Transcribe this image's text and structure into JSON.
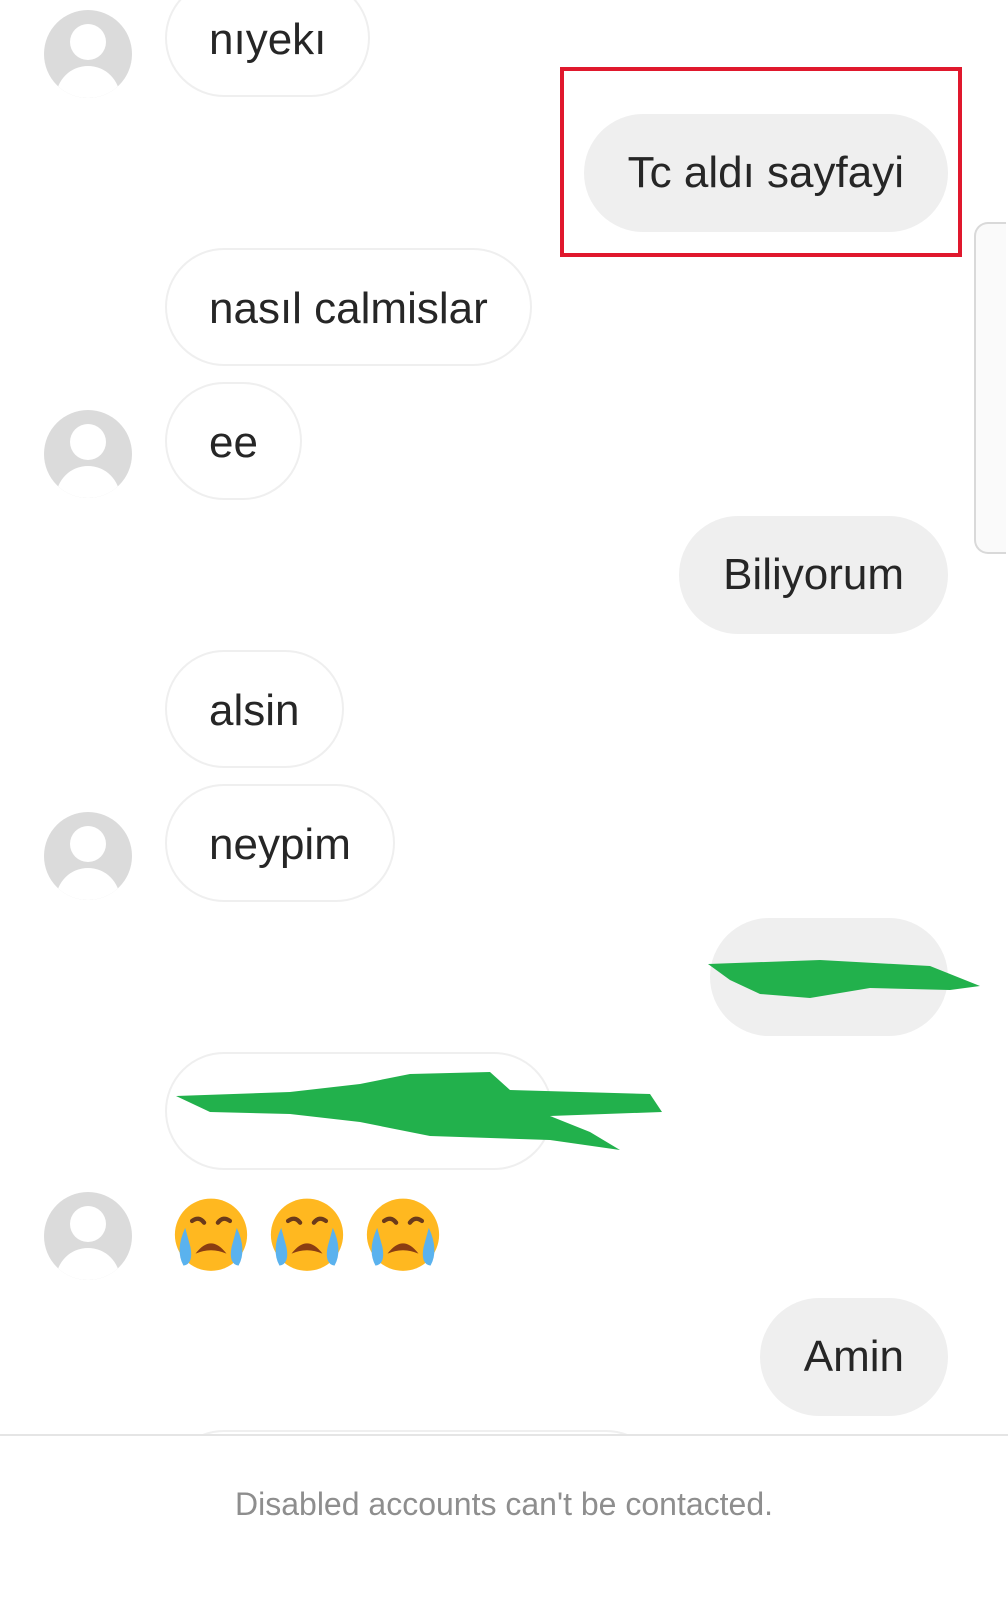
{
  "messages": [
    {
      "id": "m1",
      "from": "other",
      "text": "nıyekı",
      "avatar": true
    },
    {
      "id": "m2",
      "from": "me",
      "text": "Tc aldı sayfayi",
      "highlighted": true
    },
    {
      "id": "m3",
      "from": "other",
      "text": "nasıl calmislar",
      "avatar": false
    },
    {
      "id": "m4",
      "from": "other",
      "text": "ee",
      "avatar": true
    },
    {
      "id": "m5",
      "from": "me",
      "text": "Biliyorum"
    },
    {
      "id": "m6",
      "from": "other",
      "text": "alsin",
      "avatar": false
    },
    {
      "id": "m7",
      "from": "other",
      "text": "neypim",
      "avatar": true
    },
    {
      "id": "m8",
      "from": "me",
      "text": "",
      "redacted": true
    },
    {
      "id": "m9",
      "from": "other",
      "text": "",
      "redacted": true
    },
    {
      "id": "m10",
      "from": "other",
      "emoji": [
        "crying-face",
        "crying-face",
        "crying-face"
      ],
      "avatar": true
    },
    {
      "id": "m11",
      "from": "me",
      "text": "Amin"
    }
  ],
  "colors": {
    "incoming_border": "#efefef",
    "outgoing_bg": "#efefef",
    "highlight": "#e0182d",
    "redaction": "#22b14c",
    "footer_text": "#8e8e8e"
  },
  "footer": {
    "notice": "Disabled accounts can't be contacted."
  }
}
